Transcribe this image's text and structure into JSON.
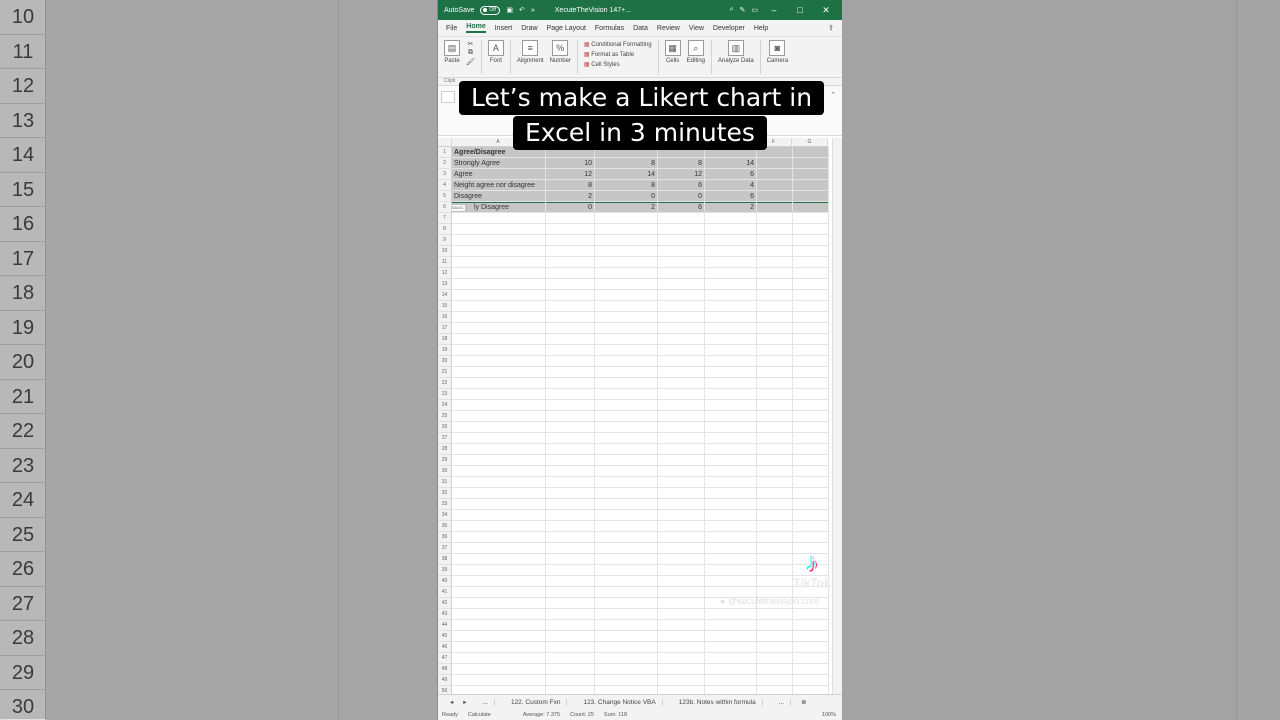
{
  "background": {
    "row_numbers": [
      "10",
      "11",
      "12",
      "13",
      "14",
      "15",
      "16",
      "17",
      "18",
      "19",
      "20",
      "21",
      "22",
      "23",
      "24",
      "25",
      "26",
      "27",
      "28",
      "29",
      "30"
    ]
  },
  "window": {
    "autosave_label": "AutoSave",
    "autosave_state": "Off",
    "title": "XecuteTheVision 147+...",
    "accent": "#1e7145"
  },
  "menu": [
    "File",
    "Home",
    "Insert",
    "Draw",
    "Page Layout",
    "Formulas",
    "Data",
    "Review",
    "View",
    "Developer",
    "Help"
  ],
  "ribbon": {
    "paste": "Paste",
    "font": "Font",
    "alignment": "Alignment",
    "number": "Number",
    "conditional_formatting": "Conditional Formatting",
    "format_as_table": "Format as Table",
    "cell_styles": "Cell Styles",
    "cells": "Cells",
    "editing": "Editing",
    "analyze_data": "Analyze Data",
    "camera": "Camera",
    "clipboard": "Clipb"
  },
  "sheet": {
    "columns": [
      "A",
      "F",
      "G"
    ],
    "header_cell": "Agree/Disagree",
    "rows": [
      {
        "label": "Strongly Agree",
        "values": [
          "10",
          "8",
          "8",
          "14"
        ]
      },
      {
        "label": "Agree",
        "values": [
          "12",
          "14",
          "12",
          "6"
        ]
      },
      {
        "label": "Neight agree nor disagree",
        "values": [
          "8",
          "8",
          "6",
          "4"
        ]
      },
      {
        "label": "Disagree",
        "values": [
          "2",
          "0",
          "0",
          "6"
        ]
      },
      {
        "label": "ly Disagree",
        "values": [
          "0",
          "2",
          "6",
          "2"
        ]
      }
    ],
    "row_numbers": [
      "1",
      "2",
      "3",
      "4",
      "5",
      "6",
      "7",
      "8",
      "9",
      "10",
      "11",
      "12",
      "13",
      "14",
      "15",
      "16",
      "17",
      "18",
      "19",
      "20",
      "21",
      "22",
      "23",
      "24",
      "25",
      "26",
      "27",
      "28",
      "29",
      "30",
      "31",
      "32",
      "33",
      "34",
      "35",
      "36",
      "37",
      "38",
      "39",
      "40",
      "41",
      "42",
      "43",
      "44",
      "45",
      "46",
      "47",
      "48",
      "49",
      "50"
    ],
    "tooltip": "5R × 16384C"
  },
  "tabs": [
    "...",
    "122. Custom Fxn",
    "123. Change Notice VBA",
    "123b. Notes within formula",
    "..."
  ],
  "status": {
    "ready": "Ready",
    "calculate": "Calculate",
    "average": "Average: 7.375",
    "count": "Count: 25",
    "sum": "Sum: 118",
    "zoom": "100%"
  },
  "caption": {
    "line1": "Let’s make a Likert chart in",
    "line2": "Excel in 3 minutes"
  },
  "watermark": {
    "brand": "TikTok",
    "user": "@xecutethevision.com"
  }
}
